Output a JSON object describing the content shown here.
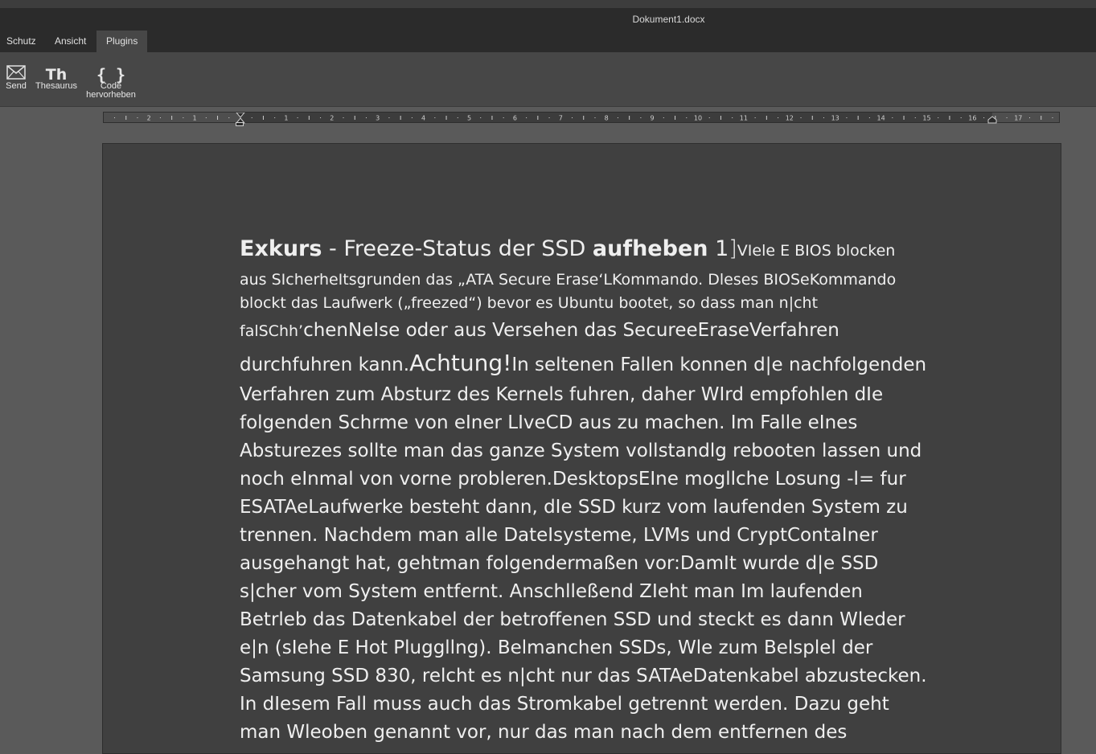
{
  "window": {
    "title": "Dokument1.docx"
  },
  "tabs": [
    {
      "label": "Schutz",
      "active": false
    },
    {
      "label": "Ansicht",
      "active": false
    },
    {
      "label": "Plugins",
      "active": true
    }
  ],
  "toolbar": {
    "send": {
      "label": "Send",
      "icon": "envelope-icon"
    },
    "thesaurus": {
      "label": "Thesaurus",
      "icon_text": "Th"
    },
    "code": {
      "label_line1": "Code",
      "label_line2": "hervorheben",
      "icon_text": "{ }"
    }
  },
  "ruler": {
    "left_labels": [
      "2",
      "1"
    ],
    "right_labels": [
      "1",
      "2",
      "3",
      "4",
      "5",
      "6",
      "7",
      "8",
      "9",
      "10",
      "11",
      "12",
      "13",
      "14",
      "15",
      "16",
      "17"
    ]
  },
  "document": {
    "heading": {
      "bold1": "Exkurs",
      "sep": " - ",
      "normal": "Freeze-Status der SSD ",
      "bold2": "aufheben",
      "num": " 1",
      "bracket": "]",
      "tail": "VIele E BIOS blocken"
    },
    "small_lines": [
      "aus SIcherheItsgrunden das „ATA Secure Erase‘LKommando. Dleses BIOSeKommando",
      "blockt das Laufwerk („freezed“) bevor es Ubuntu bootet, so dass man n|cht"
    ],
    "mixed_line": {
      "small": "falSChh’",
      "rest": "chenNeIse oder aus Versehen das SecureeEraseVerfahren"
    },
    "achtung_line": {
      "pre": "durchfuhren kann.",
      "big": "Achtung!",
      "post": "In seltenen Fallen konnen d|e nachfolgenden"
    },
    "body_lines": [
      "Verfahren zum Absturz des Kernels fuhren, daher WIrd empfohlen dIe",
      "folgenden Schrme von eIner LIveCD aus zu machen. Im Falle eInes",
      "Absturezes sollte man das ganze System vollstandlg rebooten lassen und",
      "noch eInmal von vorne probleren.DesktopsEIne mogllche Losung -l= fur",
      "ESATAeLaufwerke besteht dann, dIe SSD kurz vom laufenden System zu",
      "trennen. Nachdem man alle DateIsysteme, LVMs und CryptContaIner",
      "ausgehangt hat, gehtman folgendermaßen vor:DamIt wurde d|e SSD",
      "s|cher vom System entfernt. Anschlleßend ZIeht man Im laufenden",
      "Betrleb das Datenkabel der betroffenen SSD und steckt es dann Wleder",
      "e|n (sIehe E Hot Pluggllng). Belmanchen SSDs, Wle zum Belsplel der",
      "Samsung SSD 830, relcht es n|cht nur das SATAeDatenkabel abzustecken.",
      "In dIesem Fall muss auch das Stromkabel getrennt werden. Dazu geht",
      "man Wleoben genannt vor, nur das man nach dem entfernen des"
    ]
  }
}
